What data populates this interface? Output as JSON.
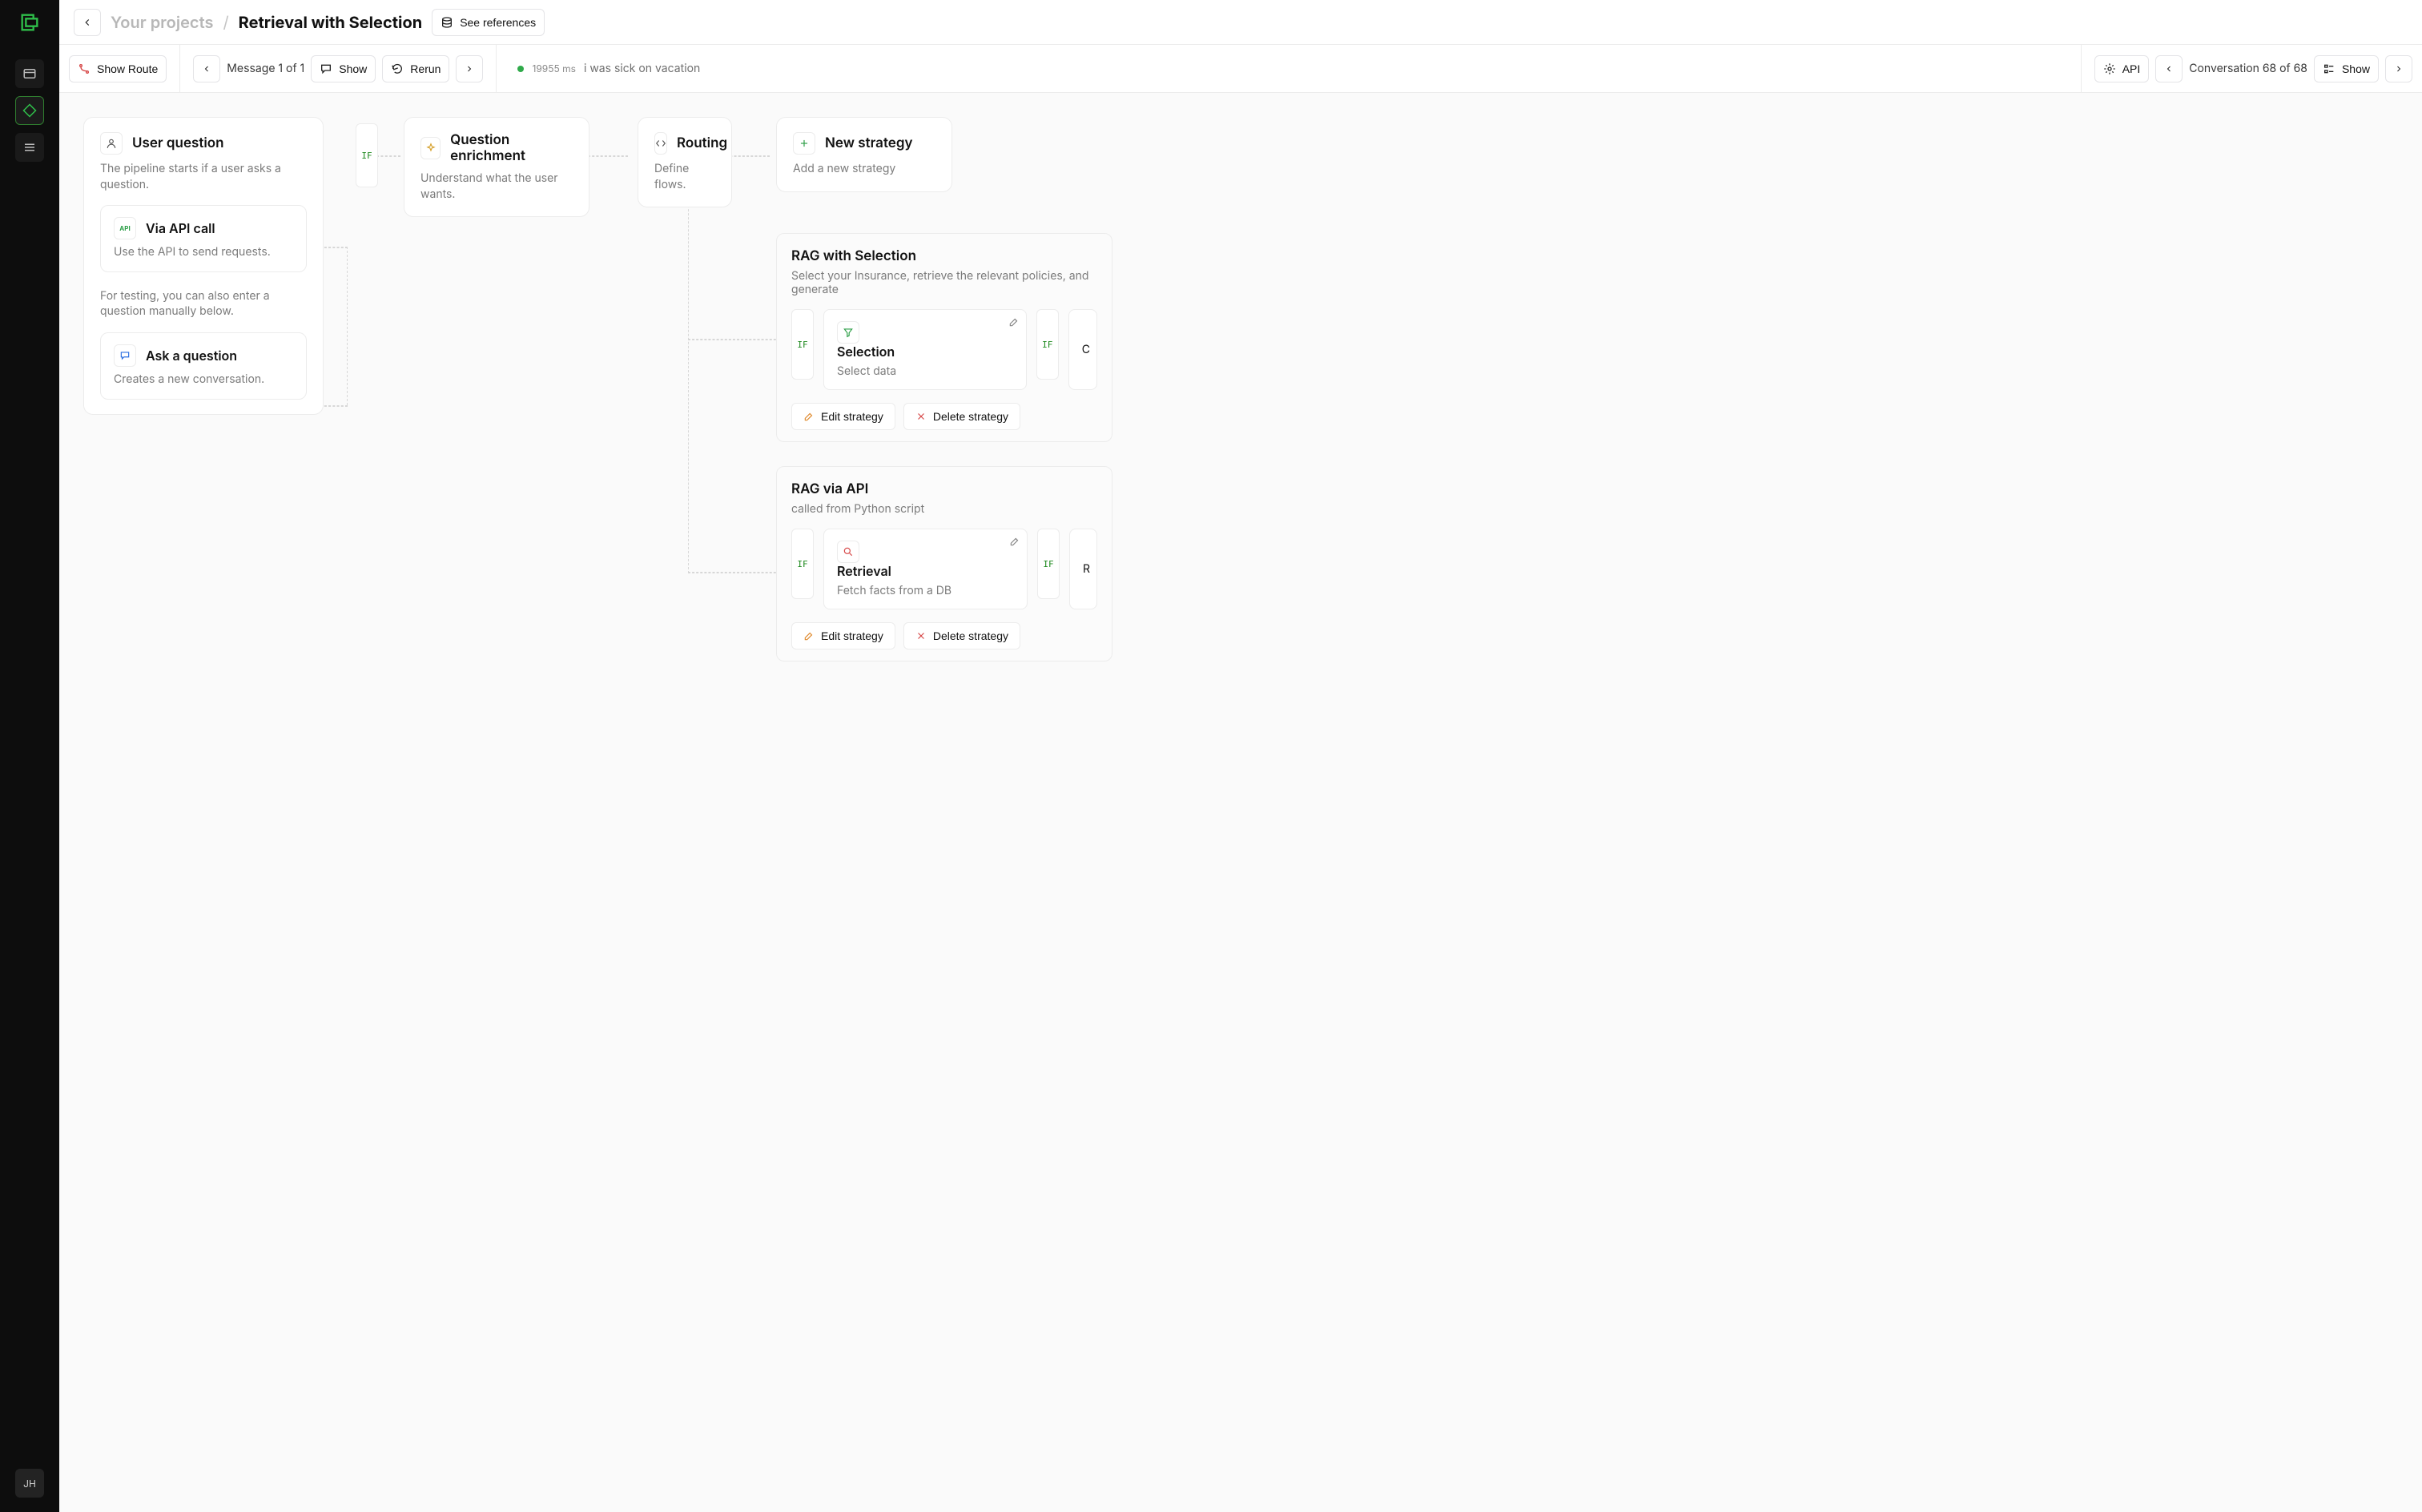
{
  "sidebar": {
    "avatar_label": "JH"
  },
  "header": {
    "breadcrumb_parent": "Your projects",
    "breadcrumb_sep": "/",
    "breadcrumb_current": "Retrieval with Selection",
    "see_references_label": "See references"
  },
  "toolbar": {
    "show_route_label": "Show Route",
    "message_counter": "Message 1  of 1",
    "show_label": "Show",
    "rerun_label": "Rerun",
    "status_time": "19955 ms",
    "status_text": "i was sick on vacation",
    "api_label": "API",
    "conversation_counter": "Conversation 68 of 68",
    "show2_label": "Show"
  },
  "nodes": {
    "user_question": {
      "title": "User question",
      "desc": "The pipeline starts if a user asks a question.",
      "api_call_title": "Via API call",
      "api_call_desc": "Use the API to send requests.",
      "testing_note": "For testing, you can also enter a question manually below.",
      "ask_title": "Ask a question",
      "ask_desc": "Creates a new conversation."
    },
    "enrichment": {
      "title": "Question enrichment",
      "desc": "Understand what the user wants."
    },
    "routing": {
      "title": "Routing",
      "desc": "Define flows."
    },
    "new_strategy": {
      "title": "New strategy",
      "desc": "Add a new strategy"
    },
    "if_label": "IF"
  },
  "strategies": {
    "rag_selection": {
      "title": "RAG with Selection",
      "desc": "Select your Insurance, retrieve the relevant policies, and generate",
      "block_title": "Selection",
      "block_desc": "Select data",
      "cut_label": "C"
    },
    "rag_api": {
      "title": "RAG via API",
      "desc": "called from Python script",
      "block_title": "Retrieval",
      "block_desc": "Fetch facts from a DB",
      "cut_label": "R"
    },
    "edit_label": "Edit strategy",
    "delete_label": "Delete strategy"
  }
}
